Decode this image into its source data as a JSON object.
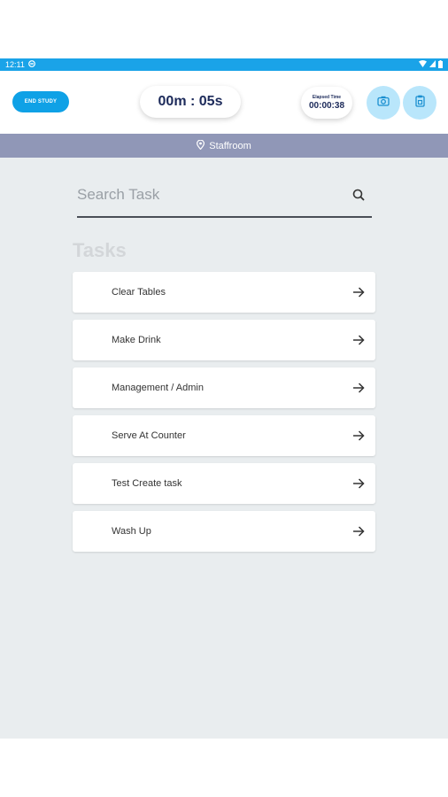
{
  "status_bar": {
    "time": "12:11"
  },
  "header": {
    "end_study_label": "END STUDY",
    "timer": "00m : 05s",
    "elapsed_label": "Elapsed Time",
    "elapsed_value": "00:00:38"
  },
  "location": {
    "name": "Staffroom"
  },
  "search": {
    "placeholder": "Search Task",
    "value": ""
  },
  "tasks_title": "Tasks",
  "tasks": [
    {
      "label": "Clear Tables"
    },
    {
      "label": "Make Drink"
    },
    {
      "label": "Management / Admin"
    },
    {
      "label": "Serve At Counter"
    },
    {
      "label": "Test Create task"
    },
    {
      "label": "Wash Up"
    }
  ],
  "colors": {
    "status_bar": "#1aa3e8",
    "accent": "#0fa1e6",
    "location_bar": "#9097b7",
    "content_bg": "#e9edef",
    "circle_button": "#b9e6fb"
  },
  "icons": [
    "status-icon",
    "wifi-icon",
    "signal-icon",
    "battery-icon",
    "camera-icon",
    "clipboard-icon",
    "location-pin-icon",
    "search-icon",
    "arrow-right-icon"
  ]
}
